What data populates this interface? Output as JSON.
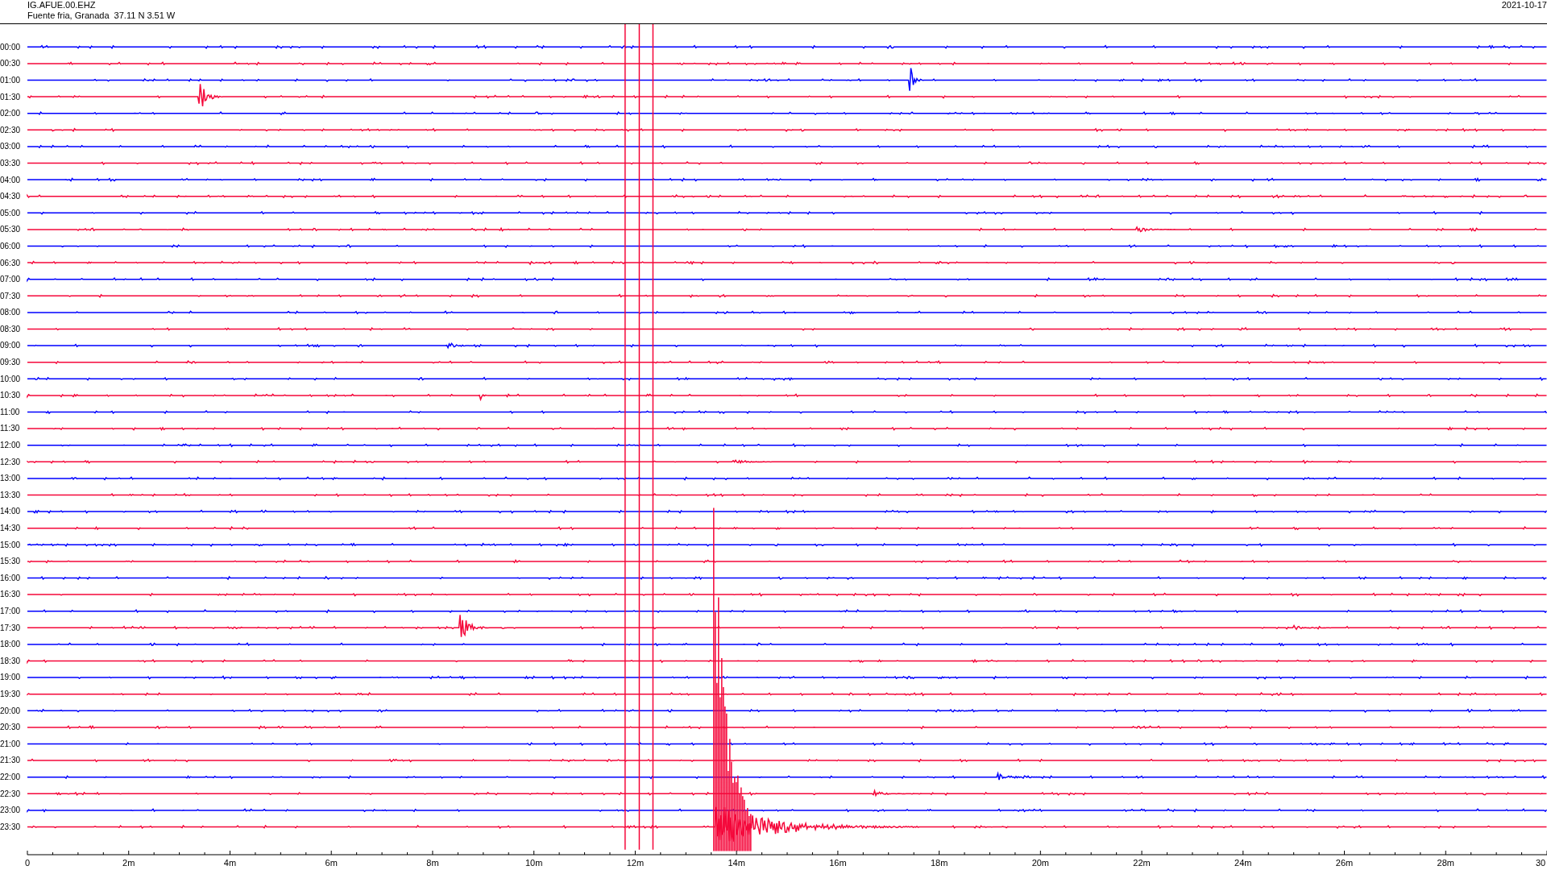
{
  "header": {
    "station": "IG.AFUE.00.EHZ",
    "location": "Fuente fria, Granada  37.11 N 3.51 W",
    "date": "2021-10-17"
  },
  "rows": [
    {
      "label": "00:00",
      "color": "#0000ff"
    },
    {
      "label": "00:30",
      "color": "#f5073a"
    },
    {
      "label": "01:00",
      "color": "#0000ff"
    },
    {
      "label": "01:30",
      "color": "#f5073a"
    },
    {
      "label": "02:00",
      "color": "#0000ff"
    },
    {
      "label": "02:30",
      "color": "#f5073a"
    },
    {
      "label": "03:00",
      "color": "#0000ff"
    },
    {
      "label": "03:30",
      "color": "#f5073a"
    },
    {
      "label": "04:00",
      "color": "#0000ff"
    },
    {
      "label": "04:30",
      "color": "#f5073a"
    },
    {
      "label": "05:00",
      "color": "#0000ff"
    },
    {
      "label": "05:30",
      "color": "#f5073a"
    },
    {
      "label": "06:00",
      "color": "#0000ff"
    },
    {
      "label": "06:30",
      "color": "#f5073a"
    },
    {
      "label": "07:00",
      "color": "#0000ff"
    },
    {
      "label": "07:30",
      "color": "#f5073a"
    },
    {
      "label": "08:00",
      "color": "#0000ff"
    },
    {
      "label": "08:30",
      "color": "#f5073a"
    },
    {
      "label": "09:00",
      "color": "#0000ff"
    },
    {
      "label": "09:30",
      "color": "#f5073a"
    },
    {
      "label": "10:00",
      "color": "#0000ff"
    },
    {
      "label": "10:30",
      "color": "#f5073a"
    },
    {
      "label": "11:00",
      "color": "#0000ff"
    },
    {
      "label": "11:30",
      "color": "#f5073a"
    },
    {
      "label": "12:00",
      "color": "#0000ff"
    },
    {
      "label": "12:30",
      "color": "#f5073a"
    },
    {
      "label": "13:00",
      "color": "#0000ff"
    },
    {
      "label": "13:30",
      "color": "#f5073a"
    },
    {
      "label": "14:00",
      "color": "#0000ff"
    },
    {
      "label": "14:30",
      "color": "#f5073a"
    },
    {
      "label": "15:00",
      "color": "#0000ff"
    },
    {
      "label": "15:30",
      "color": "#f5073a"
    },
    {
      "label": "16:00",
      "color": "#0000ff"
    },
    {
      "label": "16:30",
      "color": "#f5073a"
    },
    {
      "label": "17:00",
      "color": "#0000ff"
    },
    {
      "label": "17:30",
      "color": "#f5073a"
    },
    {
      "label": "18:00",
      "color": "#0000ff"
    },
    {
      "label": "18:30",
      "color": "#f5073a"
    },
    {
      "label": "19:00",
      "color": "#0000ff"
    },
    {
      "label": "19:30",
      "color": "#f5073a"
    },
    {
      "label": "20:00",
      "color": "#0000ff"
    },
    {
      "label": "20:30",
      "color": "#f5073a"
    },
    {
      "label": "21:00",
      "color": "#0000ff"
    },
    {
      "label": "21:30",
      "color": "#f5073a"
    },
    {
      "label": "22:00",
      "color": "#0000ff"
    },
    {
      "label": "22:30",
      "color": "#f5073a"
    },
    {
      "label": "23:00",
      "color": "#0000ff"
    },
    {
      "label": "23:30",
      "color": "#f5073a"
    }
  ],
  "x_axis": {
    "tick_labels": [
      "0",
      "2m",
      "4m",
      "6m",
      "8m",
      "10m",
      "12m",
      "14m",
      "16m",
      "18m",
      "20m",
      "22m",
      "24m",
      "26m",
      "28m",
      "30"
    ]
  }
}
